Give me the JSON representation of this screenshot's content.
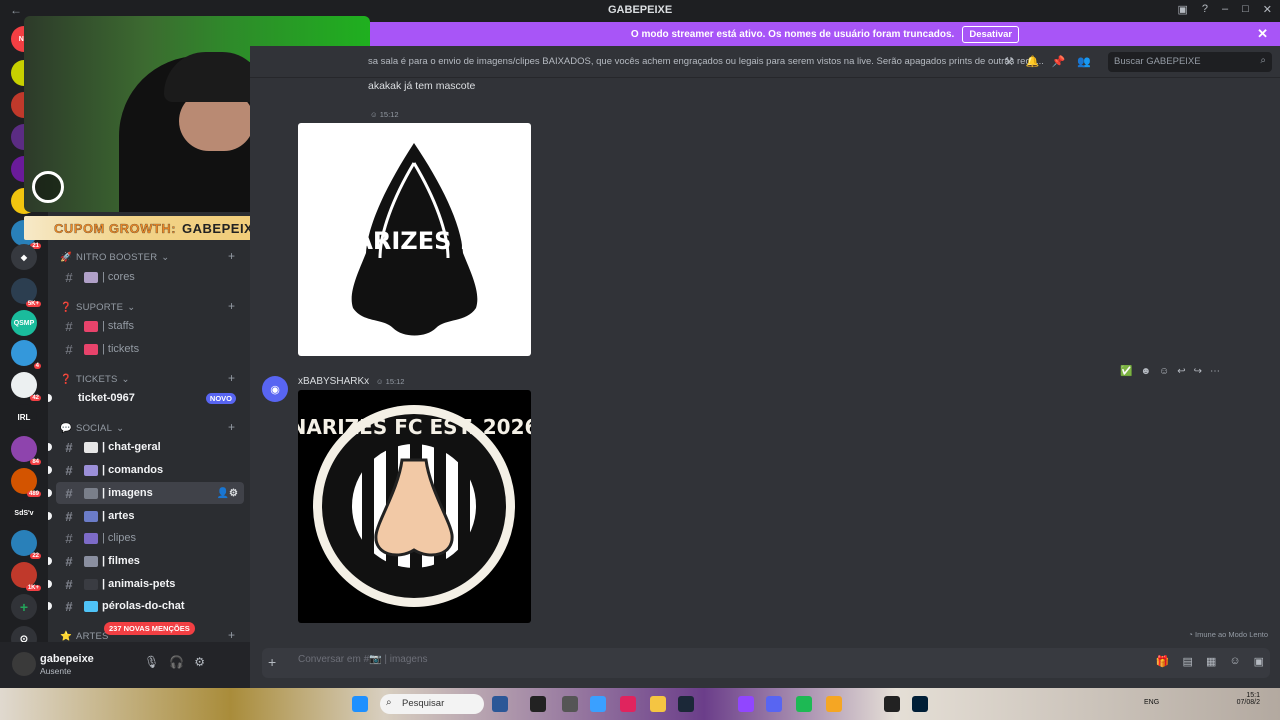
{
  "window": {
    "title": "GABEPEIXE",
    "back_icon": "arrow-left-icon"
  },
  "streamer_banner": {
    "text": "O modo streamer está ativo. Os nomes de usuário foram truncados.",
    "button": "Desativar"
  },
  "guild_badges": [
    "NO",
    "1",
    "23",
    "21",
    "5K+",
    "4",
    "42",
    "84",
    "489",
    "22",
    "1K+"
  ],
  "guild_labels": [
    "IRL",
    "SdS'v"
  ],
  "overlay": {
    "coupon_label": "CUPOM GROWTH:",
    "coupon_code": "GABEPEIXE"
  },
  "sidebar": {
    "categories": [
      {
        "label": "NITRO BOOSTER",
        "emoji": "🚀"
      },
      {
        "label": "SUPORTE",
        "emoji": "❓"
      },
      {
        "label": "TICKETS",
        "emoji": "❓"
      },
      {
        "label": "SOCIAL",
        "emoji": "💬"
      },
      {
        "label": "ARTES",
        "emoji": "⭐"
      }
    ],
    "channels": [
      {
        "label": "| cores",
        "unread": false
      },
      {
        "label": "| staffs",
        "unread": false
      },
      {
        "label": "| tickets",
        "unread": false
      },
      {
        "label": "ticket-0967",
        "unread": true,
        "badge": "NOVO"
      },
      {
        "label": "| chat-geral",
        "unread": true
      },
      {
        "label": "| comandos",
        "unread": true
      },
      {
        "label": "| imagens",
        "unread": true,
        "active": true
      },
      {
        "label": "| artes",
        "unread": true
      },
      {
        "label": "| clipes",
        "unread": false
      },
      {
        "label": "| filmes",
        "unread": true
      },
      {
        "label": "| animais-pets",
        "unread": true
      },
      {
        "label": "pérolas-do-chat",
        "unread": true
      }
    ],
    "mentions_pill": "237 NOVAS MENÇÕES"
  },
  "user": {
    "name": "gabepeixe",
    "status": "Ausente"
  },
  "channel_header": {
    "topic": "sa sala é para o envio de imagens/clipes BAIXADOS, que vocês achem engraçados ou legais para serem vistos na live. Serão apagados prints de outras rede...",
    "search_placeholder": "Buscar GABEPEIXE"
  },
  "messages": [
    {
      "text": "akakak já tem mascote",
      "time": "15:12",
      "image_alt": "NARIZES FC"
    },
    {
      "author": "xBABYSHARKx",
      "time": "15:12",
      "image_alt": "NARIZES FC EST. 2026"
    }
  ],
  "slow_mode_note": "Imune ao Modo Lento",
  "composer": {
    "placeholder": "Conversar em #📷 | imagens"
  },
  "taskbar": {
    "search": "Pesquisar",
    "lang": "ENG",
    "time": "15:1",
    "date": "07/08/2"
  },
  "colors": {
    "accent": "#5865f2",
    "streamer_banner": "#a855f7",
    "mention": "#f23f43"
  }
}
